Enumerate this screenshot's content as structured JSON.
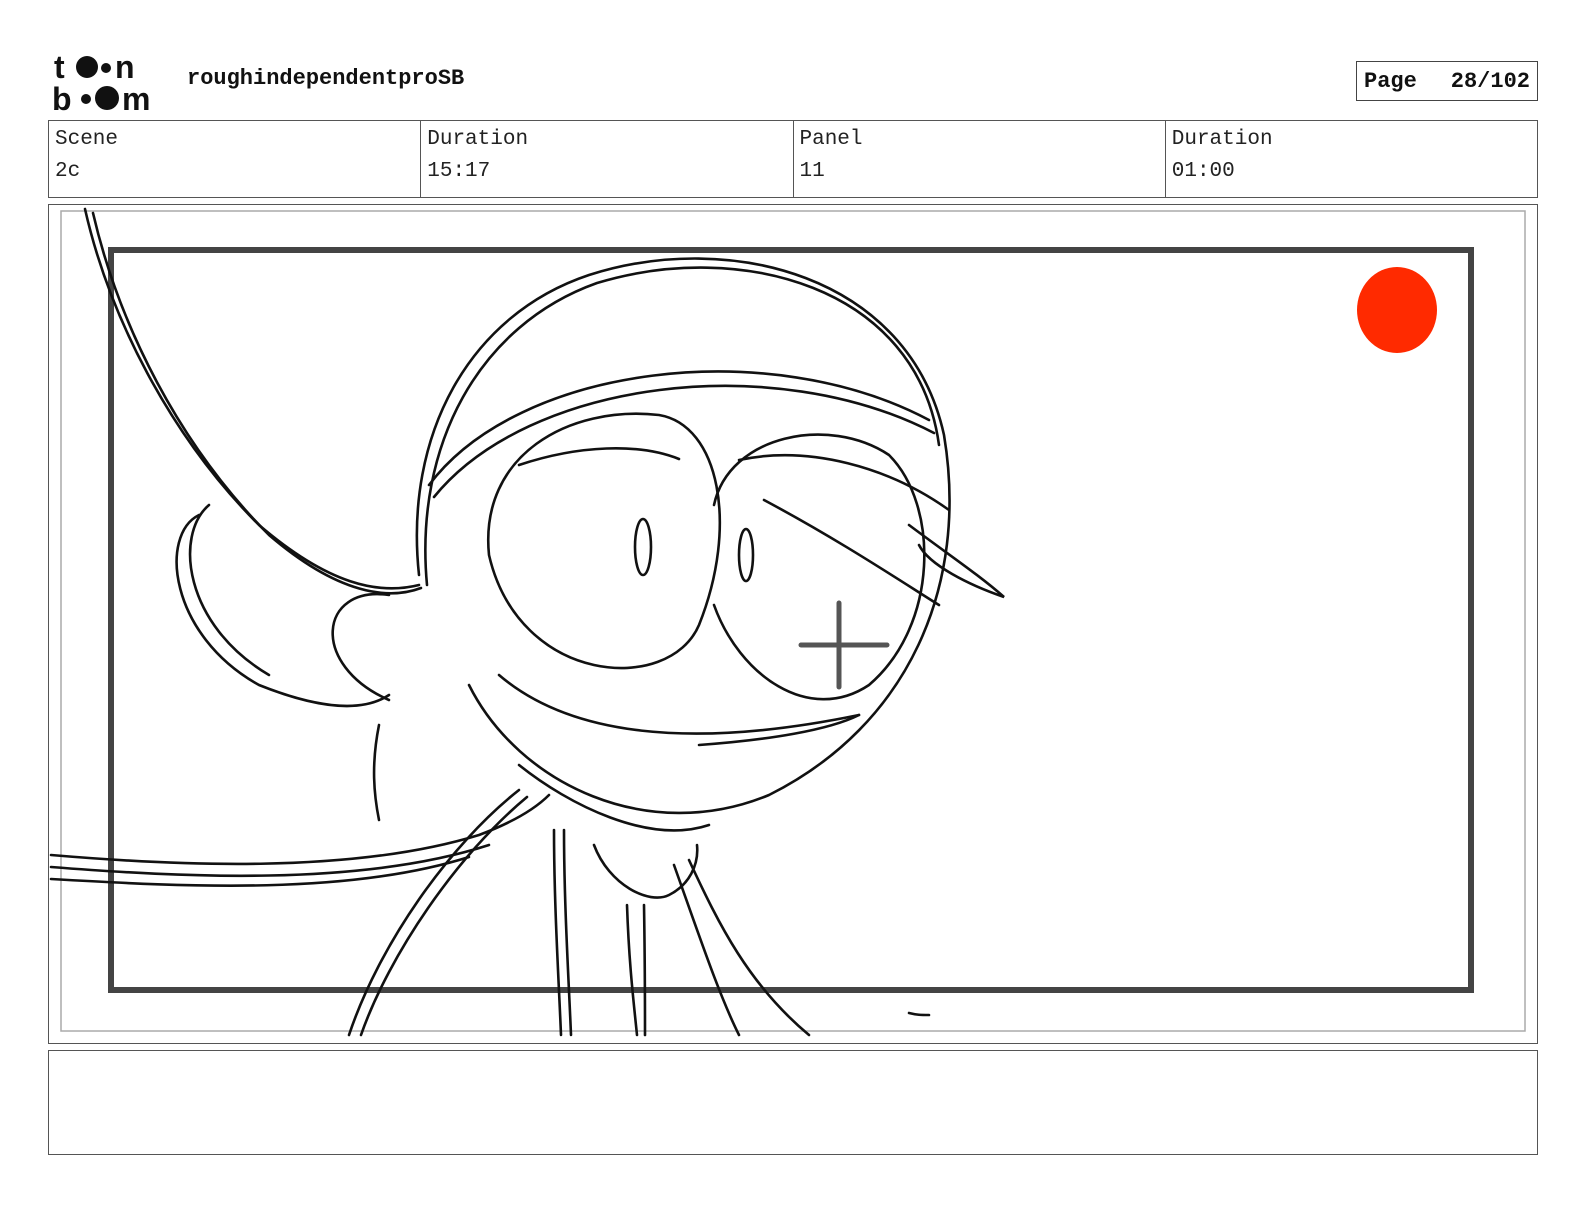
{
  "header": {
    "logo_top": "to•n",
    "logo_bottom": "b••m",
    "project_title": "roughindependentproSB",
    "page_label": "Page",
    "page_value": "28/102"
  },
  "info": {
    "scene_label": "Scene",
    "scene_value": "2c",
    "scene_duration_label": "Duration",
    "scene_duration_value": "15:17",
    "panel_label": "Panel",
    "panel_value": "11",
    "panel_duration_label": "Duration",
    "panel_duration_value": "01:00"
  },
  "colors": {
    "record_dot": "#ff2a00",
    "sketch_line": "#111111",
    "camera_frame": "#444444"
  },
  "icons": {
    "camera_center": "crosshair-icon",
    "record_marker": "record-dot-icon"
  },
  "notes": {
    "text": ""
  }
}
